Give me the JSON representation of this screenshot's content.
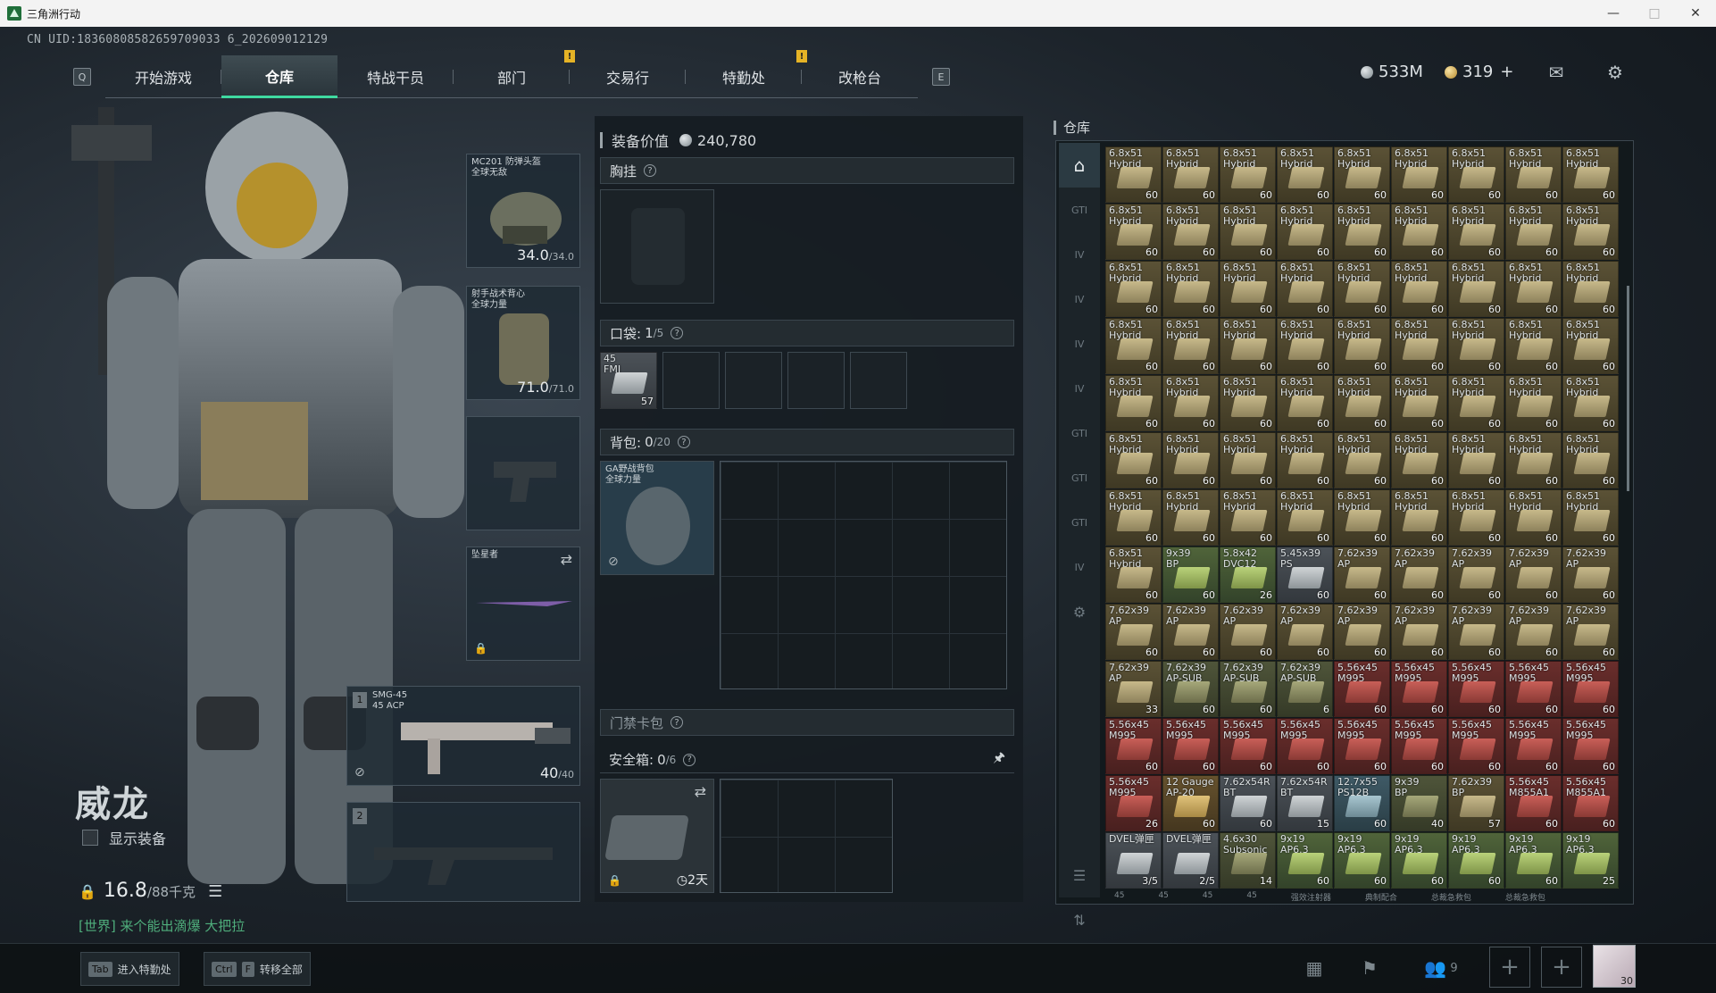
{
  "window": {
    "title": "三角洲行动"
  },
  "uid": "CN UID:18360808582659709033 6_202609012129",
  "nav": {
    "left_key": "Q",
    "right_key": "E",
    "tabs": [
      {
        "label": "开始游戏",
        "alert": false
      },
      {
        "label": "仓库",
        "alert": false,
        "active": true
      },
      {
        "label": "特战干员",
        "alert": false
      },
      {
        "label": "部门",
        "alert": true
      },
      {
        "label": "交易行",
        "alert": false
      },
      {
        "label": "特勤处",
        "alert": true
      },
      {
        "label": "改枪台",
        "alert": false
      }
    ]
  },
  "currency": {
    "silver": "533M",
    "gold": "319",
    "gold_add": "+"
  },
  "operator": {
    "name": "威龙",
    "show_equipment_label": "显示装备",
    "weight": "16.8",
    "weight_max": "/88千克",
    "chat": "[世界] 来个能出滴爆 大把拉"
  },
  "equipment": {
    "helmet": {
      "label": "MC201 防弹头盔\n全球无敌",
      "value": "34.0",
      "max": "/34.0"
    },
    "armor": {
      "label": "射手战术背心\n全球力量",
      "value": "71.0",
      "max": "/71.0"
    },
    "melee": {
      "label": "坠星者"
    },
    "primary": {
      "num": "1",
      "label": "SMG-45\n45 ACP",
      "value": "40",
      "max": "/40"
    },
    "secondary": {
      "num": "2"
    }
  },
  "loadout": {
    "value_label": "装备价值",
    "value": "240,780",
    "chest": {
      "label": "胸挂",
      "q": "?"
    },
    "pocket": {
      "label": "口袋:",
      "count": "1",
      "max": "/5",
      "q": "?",
      "item_name": "45\nFMJ",
      "item_count": "57"
    },
    "backpack": {
      "label": "背包:",
      "count": "0",
      "max": "/20",
      "q": "?",
      "item_name": "GA野战背包\n全球力量"
    },
    "keycard": {
      "label": "门禁卡包",
      "q": "?"
    },
    "safebox": {
      "label": "安全箱:",
      "count": "0",
      "max": "/6",
      "q": "?",
      "timer": "2天"
    }
  },
  "warehouse": {
    "title": "仓库",
    "side_tabs": [
      "home",
      "GTI",
      "IV",
      "IV",
      "IV",
      "IV",
      "GTI",
      "GTI",
      "GTI",
      "IV",
      "gear"
    ],
    "items": [
      {
        "n": "6.8x51\nHybrid",
        "c": "60",
        "t": "tan"
      },
      {
        "n": "6.8x51\nHybrid",
        "c": "60",
        "t": "tan"
      },
      {
        "n": "6.8x51\nHybrid",
        "c": "60",
        "t": "tan"
      },
      {
        "n": "6.8x51\nHybrid",
        "c": "60",
        "t": "tan"
      },
      {
        "n": "6.8x51\nHybrid",
        "c": "60",
        "t": "tan"
      },
      {
        "n": "6.8x51\nHybrid",
        "c": "60",
        "t": "tan"
      },
      {
        "n": "6.8x51\nHybrid",
        "c": "60",
        "t": "tan"
      },
      {
        "n": "6.8x51\nHybrid",
        "c": "60",
        "t": "tan"
      },
      {
        "n": "6.8x51\nHybrid",
        "c": "60",
        "t": "tan"
      },
      {
        "n": "6.8x51\nHybrid",
        "c": "60",
        "t": "tan"
      },
      {
        "n": "6.8x51\nHybrid",
        "c": "60",
        "t": "tan"
      },
      {
        "n": "6.8x51\nHybrid",
        "c": "60",
        "t": "tan"
      },
      {
        "n": "6.8x51\nHybrid",
        "c": "60",
        "t": "tan"
      },
      {
        "n": "6.8x51\nHybrid",
        "c": "60",
        "t": "tan"
      },
      {
        "n": "6.8x51\nHybrid",
        "c": "60",
        "t": "tan"
      },
      {
        "n": "6.8x51\nHybrid",
        "c": "60",
        "t": "tan"
      },
      {
        "n": "6.8x51\nHybrid",
        "c": "60",
        "t": "tan"
      },
      {
        "n": "6.8x51\nHybrid",
        "c": "60",
        "t": "tan"
      },
      {
        "n": "6.8x51\nHybrid",
        "c": "60",
        "t": "tan"
      },
      {
        "n": "6.8x51\nHybrid",
        "c": "60",
        "t": "tan"
      },
      {
        "n": "6.8x51\nHybrid",
        "c": "60",
        "t": "tan"
      },
      {
        "n": "6.8x51\nHybrid",
        "c": "60",
        "t": "tan"
      },
      {
        "n": "6.8x51\nHybrid",
        "c": "60",
        "t": "tan"
      },
      {
        "n": "6.8x51\nHybrid",
        "c": "60",
        "t": "tan"
      },
      {
        "n": "6.8x51\nHybrid",
        "c": "60",
        "t": "tan"
      },
      {
        "n": "6.8x51\nHybrid",
        "c": "60",
        "t": "tan"
      },
      {
        "n": "6.8x51\nHybrid",
        "c": "60",
        "t": "tan"
      },
      {
        "n": "6.8x51\nHybrid",
        "c": "60",
        "t": "tan"
      },
      {
        "n": "6.8x51\nHybrid",
        "c": "60",
        "t": "tan"
      },
      {
        "n": "6.8x51\nHybrid",
        "c": "60",
        "t": "tan"
      },
      {
        "n": "6.8x51\nHybrid",
        "c": "60",
        "t": "tan"
      },
      {
        "n": "6.8x51\nHybrid",
        "c": "60",
        "t": "tan"
      },
      {
        "n": "6.8x51\nHybrid",
        "c": "60",
        "t": "tan"
      },
      {
        "n": "6.8x51\nHybrid",
        "c": "60",
        "t": "tan"
      },
      {
        "n": "6.8x51\nHybrid",
        "c": "60",
        "t": "tan"
      },
      {
        "n": "6.8x51\nHybrid",
        "c": "60",
        "t": "tan"
      },
      {
        "n": "6.8x51\nHybrid",
        "c": "60",
        "t": "tan"
      },
      {
        "n": "6.8x51\nHybrid",
        "c": "60",
        "t": "tan"
      },
      {
        "n": "6.8x51\nHybrid",
        "c": "60",
        "t": "tan"
      },
      {
        "n": "6.8x51\nHybrid",
        "c": "60",
        "t": "tan"
      },
      {
        "n": "6.8x51\nHybrid",
        "c": "60",
        "t": "tan"
      },
      {
        "n": "6.8x51\nHybrid",
        "c": "60",
        "t": "tan"
      },
      {
        "n": "6.8x51\nHybrid",
        "c": "60",
        "t": "tan"
      },
      {
        "n": "6.8x51\nHybrid",
        "c": "60",
        "t": "tan"
      },
      {
        "n": "6.8x51\nHybrid",
        "c": "60",
        "t": "tan"
      },
      {
        "n": "6.8x51\nHybrid",
        "c": "60",
        "t": "tan"
      },
      {
        "n": "6.8x51\nHybrid",
        "c": "60",
        "t": "tan"
      },
      {
        "n": "6.8x51\nHybrid",
        "c": "60",
        "t": "tan"
      },
      {
        "n": "6.8x51\nHybrid",
        "c": "60",
        "t": "tan"
      },
      {
        "n": "6.8x51\nHybrid",
        "c": "60",
        "t": "tan"
      },
      {
        "n": "6.8x51\nHybrid",
        "c": "60",
        "t": "tan"
      },
      {
        "n": "6.8x51\nHybrid",
        "c": "60",
        "t": "tan"
      },
      {
        "n": "6.8x51\nHybrid",
        "c": "60",
        "t": "tan"
      },
      {
        "n": "6.8x51\nHybrid",
        "c": "60",
        "t": "tan"
      },
      {
        "n": "6.8x51\nHybrid",
        "c": "60",
        "t": "tan"
      },
      {
        "n": "6.8x51\nHybrid",
        "c": "60",
        "t": "tan"
      },
      {
        "n": "6.8x51\nHybrid",
        "c": "60",
        "t": "tan"
      },
      {
        "n": "6.8x51\nHybrid",
        "c": "60",
        "t": "tan"
      },
      {
        "n": "6.8x51\nHybrid",
        "c": "60",
        "t": "tan"
      },
      {
        "n": "6.8x51\nHybrid",
        "c": "60",
        "t": "tan"
      },
      {
        "n": "6.8x51\nHybrid",
        "c": "60",
        "t": "tan"
      },
      {
        "n": "6.8x51\nHybrid",
        "c": "60",
        "t": "tan"
      },
      {
        "n": "6.8x51\nHybrid",
        "c": "60",
        "t": "tan"
      },
      {
        "n": "6.8x51\nHybrid",
        "c": "60",
        "t": "tan"
      },
      {
        "n": "9x39\nBP",
        "c": "60",
        "t": "green"
      },
      {
        "n": "5.8x42\nDVC12",
        "c": "26",
        "t": "green"
      },
      {
        "n": "5.45x39\nPS",
        "c": "60",
        "t": "grey"
      },
      {
        "n": "7.62x39\nAP",
        "c": "60",
        "t": "tan"
      },
      {
        "n": "7.62x39\nAP",
        "c": "60",
        "t": "tan"
      },
      {
        "n": "7.62x39\nAP",
        "c": "60",
        "t": "tan"
      },
      {
        "n": "7.62x39\nAP",
        "c": "60",
        "t": "tan"
      },
      {
        "n": "7.62x39\nAP",
        "c": "60",
        "t": "tan"
      },
      {
        "n": "7.62x39\nAP",
        "c": "60",
        "t": "tan"
      },
      {
        "n": "7.62x39\nAP",
        "c": "60",
        "t": "tan"
      },
      {
        "n": "7.62x39\nAP",
        "c": "60",
        "t": "tan"
      },
      {
        "n": "7.62x39\nAP",
        "c": "60",
        "t": "tan"
      },
      {
        "n": "7.62x39\nAP",
        "c": "60",
        "t": "tan"
      },
      {
        "n": "7.62x39\nAP",
        "c": "60",
        "t": "tan"
      },
      {
        "n": "7.62x39\nAP",
        "c": "60",
        "t": "tan"
      },
      {
        "n": "7.62x39\nAP",
        "c": "60",
        "t": "tan"
      },
      {
        "n": "7.62x39\nAP",
        "c": "60",
        "t": "tan"
      },
      {
        "n": "7.62x39\nAP",
        "c": "33",
        "t": "tan"
      },
      {
        "n": "7.62x39\nAP-SUB",
        "c": "60",
        "t": "olive"
      },
      {
        "n": "7.62x39\nAP-SUB",
        "c": "60",
        "t": "olive"
      },
      {
        "n": "7.62x39\nAP-SUB",
        "c": "6",
        "t": "olive"
      },
      {
        "n": "5.56x45\nM995",
        "c": "60",
        "t": "red"
      },
      {
        "n": "5.56x45\nM995",
        "c": "60",
        "t": "red"
      },
      {
        "n": "5.56x45\nM995",
        "c": "60",
        "t": "red"
      },
      {
        "n": "5.56x45\nM995",
        "c": "60",
        "t": "red"
      },
      {
        "n": "5.56x45\nM995",
        "c": "60",
        "t": "red"
      },
      {
        "n": "5.56x45\nM995",
        "c": "60",
        "t": "red"
      },
      {
        "n": "5.56x45\nM995",
        "c": "60",
        "t": "red"
      },
      {
        "n": "5.56x45\nM995",
        "c": "60",
        "t": "red"
      },
      {
        "n": "5.56x45\nM995",
        "c": "60",
        "t": "red"
      },
      {
        "n": "5.56x45\nM995",
        "c": "60",
        "t": "red"
      },
      {
        "n": "5.56x45\nM995",
        "c": "60",
        "t": "red"
      },
      {
        "n": "5.56x45\nM995",
        "c": "60",
        "t": "red"
      },
      {
        "n": "5.56x45\nM995",
        "c": "60",
        "t": "red"
      },
      {
        "n": "5.56x45\nM995",
        "c": "60",
        "t": "red"
      },
      {
        "n": "5.56x45\nM995",
        "c": "26",
        "t": "red"
      },
      {
        "n": "12 Gauge\nAP-20",
        "c": "60",
        "t": "gold"
      },
      {
        "n": "7.62x54R\nBT",
        "c": "60",
        "t": "grey"
      },
      {
        "n": "7.62x54R\nBT",
        "c": "15",
        "t": "grey"
      },
      {
        "n": "12.7x55\nPS12B",
        "c": "60",
        "t": "blue"
      },
      {
        "n": "9x39\nBP",
        "c": "40",
        "t": "olive"
      },
      {
        "n": "7.62x39\nBP",
        "c": "57",
        "t": "tan"
      },
      {
        "n": "5.56x45\nM855A1",
        "c": "60",
        "t": "red"
      },
      {
        "n": "5.56x45\nM855A1",
        "c": "60",
        "t": "red"
      },
      {
        "n": "DVEL弹匣",
        "c": "3/5",
        "t": "grey"
      },
      {
        "n": "DVEL弹匣",
        "c": "2/5",
        "t": "grey"
      },
      {
        "n": "4.6x30\nSubsonic",
        "c": "14",
        "t": "olive"
      },
      {
        "n": "9x19\nAP6.3",
        "c": "60",
        "t": "green"
      },
      {
        "n": "9x19\nAP6.3",
        "c": "60",
        "t": "green"
      },
      {
        "n": "9x19\nAP6.3",
        "c": "60",
        "t": "green"
      },
      {
        "n": "9x19\nAP6.3",
        "c": "60",
        "t": "green"
      },
      {
        "n": "9x19\nAP6.3",
        "c": "60",
        "t": "green"
      },
      {
        "n": "9x19\nAP6.3",
        "c": "25",
        "t": "green"
      }
    ],
    "bottom_labels": [
      "45",
      "45",
      "45",
      "45",
      "强效注射器",
      "典制配合",
      "总裁急救包",
      "总裁急救包"
    ]
  },
  "bottom": {
    "hotkey_tab": {
      "key": "Tab",
      "label": "进入特勤处"
    },
    "hotkey_transfer": {
      "key1": "Ctrl",
      "key2": "F",
      "label": "转移全部"
    },
    "friends_count": "9",
    "avatar_level": "30"
  }
}
